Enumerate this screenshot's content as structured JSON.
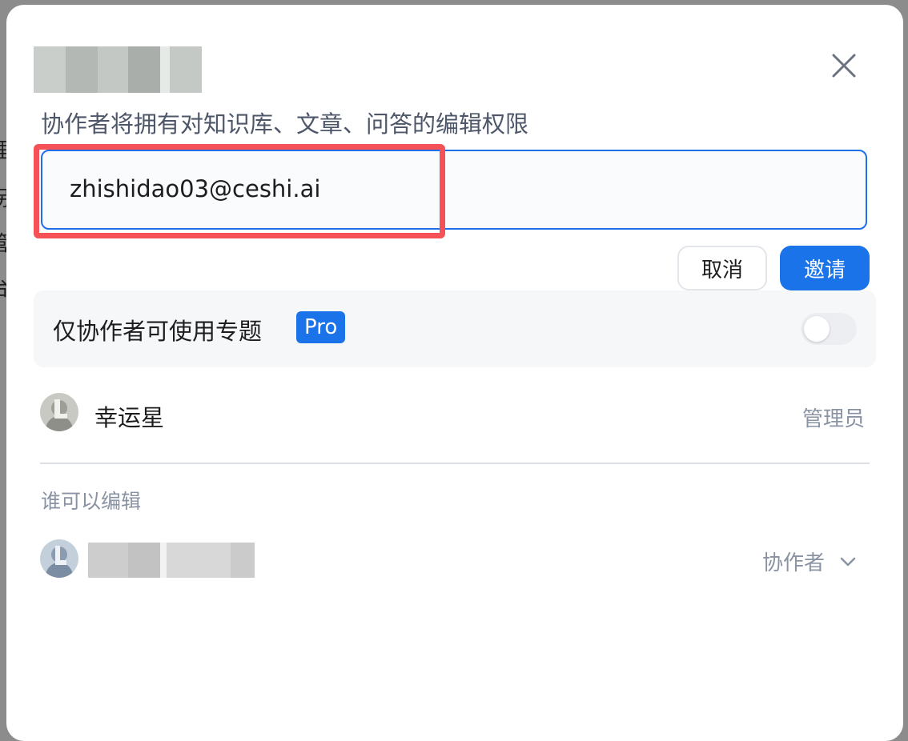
{
  "dialog": {
    "subtitle": "协作者将拥有对知识库、文章、问答的编辑权限",
    "close_icon": "close-icon"
  },
  "invite": {
    "input_value": "zhishidao03@ceshi.ai",
    "cancel_label": "取消",
    "invite_label": "邀请"
  },
  "option": {
    "label": "仅协作者可使用专题",
    "badge": "Pro",
    "toggle_on": false
  },
  "owner": {
    "name": "幸运星",
    "role": "管理员"
  },
  "collaborators": {
    "section_title": "谁可以编辑",
    "items": [
      {
        "role": "协作者"
      }
    ]
  },
  "colors": {
    "accent": "#1a73e8",
    "highlight": "#f55258",
    "muted_text": "#8a93a3"
  }
}
